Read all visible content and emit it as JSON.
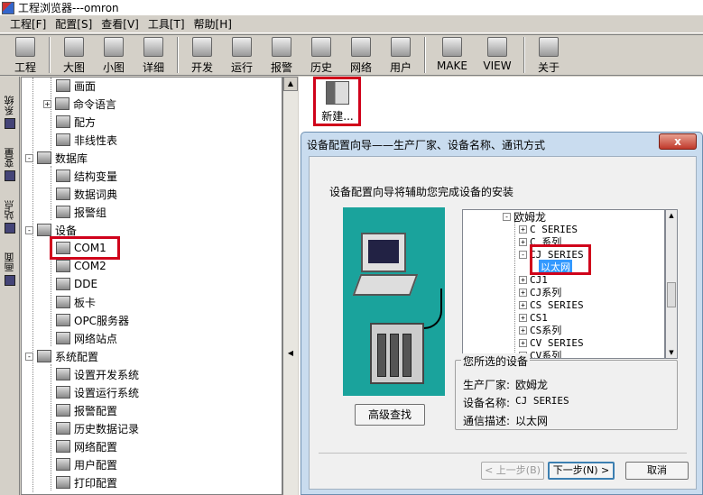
{
  "window": {
    "title": "工程浏览器---omron"
  },
  "menu": [
    "工程[F]",
    "配置[S]",
    "查看[V]",
    "工具[T]",
    "帮助[H]"
  ],
  "toolbar": [
    {
      "label": "工程",
      "icon": "project-icon"
    },
    {
      "label": "大图",
      "icon": "large-icons-icon"
    },
    {
      "label": "小图",
      "icon": "small-icons-icon"
    },
    {
      "label": "详细",
      "icon": "details-icon"
    },
    {
      "label": "开发",
      "icon": "develop-icon"
    },
    {
      "label": "运行",
      "icon": "run-icon"
    },
    {
      "label": "报警",
      "icon": "alarm-icon"
    },
    {
      "label": "历史",
      "icon": "history-icon"
    },
    {
      "label": "网络",
      "icon": "network-icon"
    },
    {
      "label": "用户",
      "icon": "user-icon"
    },
    {
      "label": "MAKE",
      "icon": "make-icon"
    },
    {
      "label": "VIEW",
      "icon": "view-icon"
    },
    {
      "label": "关于",
      "icon": "about-icon"
    }
  ],
  "side_tabs": [
    "系统",
    "变量",
    "站点",
    "画面"
  ],
  "tree": [
    {
      "label": "画面",
      "level": 2
    },
    {
      "label": "命令语言",
      "level": 2,
      "expander": "+"
    },
    {
      "label": "配方",
      "level": 2
    },
    {
      "label": "非线性表",
      "level": 2
    },
    {
      "label": "数据库",
      "level": 1,
      "expander": "-"
    },
    {
      "label": "结构变量",
      "level": 2
    },
    {
      "label": "数据词典",
      "level": 2
    },
    {
      "label": "报警组",
      "level": 2
    },
    {
      "label": "设备",
      "level": 1,
      "expander": "-"
    },
    {
      "label": "COM1",
      "level": 2,
      "highlight": true
    },
    {
      "label": "COM2",
      "level": 2
    },
    {
      "label": "DDE",
      "level": 2
    },
    {
      "label": "板卡",
      "level": 2
    },
    {
      "label": "OPC服务器",
      "level": 2
    },
    {
      "label": "网络站点",
      "level": 2
    },
    {
      "label": "系统配置",
      "level": 1,
      "expander": "-"
    },
    {
      "label": "设置开发系统",
      "level": 2
    },
    {
      "label": "设置运行系统",
      "level": 2
    },
    {
      "label": "报警配置",
      "level": 2
    },
    {
      "label": "历史数据记录",
      "level": 2
    },
    {
      "label": "网络配置",
      "level": 2
    },
    {
      "label": "用户配置",
      "level": 2
    },
    {
      "label": "打印配置",
      "level": 2
    }
  ],
  "main": {
    "new_label": "新建..."
  },
  "dialog": {
    "title": "设备配置向导——生产厂家、设备名称、通讯方式",
    "close": "x",
    "intro": "设备配置向导将辅助您完成设备的安装",
    "advanced_button": "高级查找",
    "device_tree": [
      {
        "label": "欧姆龙",
        "level": 0,
        "expander": "-"
      },
      {
        "label": "C SERIES",
        "level": 1,
        "expander": "+"
      },
      {
        "label": "C 系列",
        "level": 1,
        "expander": "+"
      },
      {
        "label": "CJ SERIES",
        "level": 1,
        "expander": "-"
      },
      {
        "label": "以太网",
        "level": 2,
        "selected": true
      },
      {
        "label": "CJ1",
        "level": 1,
        "expander": "+"
      },
      {
        "label": "CJ系列",
        "level": 1,
        "expander": "+"
      },
      {
        "label": "CS SERIES",
        "level": 1,
        "expander": "+"
      },
      {
        "label": "CS1",
        "level": 1,
        "expander": "+"
      },
      {
        "label": "CS系列",
        "level": 1,
        "expander": "+"
      },
      {
        "label": "CV SERIES",
        "level": 1,
        "expander": "+"
      },
      {
        "label": "CV系列",
        "level": 1,
        "expander": "+"
      }
    ],
    "selection": {
      "legend": "您所选的设备",
      "manufacturer_label": "生产厂家:",
      "manufacturer": "欧姆龙",
      "device_label": "设备名称:",
      "device": "CJ SERIES",
      "comm_label": "通信描述:",
      "comm": "以太网"
    },
    "buttons": {
      "back": "< 上一步(B)",
      "next": "下一步(N) >",
      "cancel": "取消"
    }
  }
}
